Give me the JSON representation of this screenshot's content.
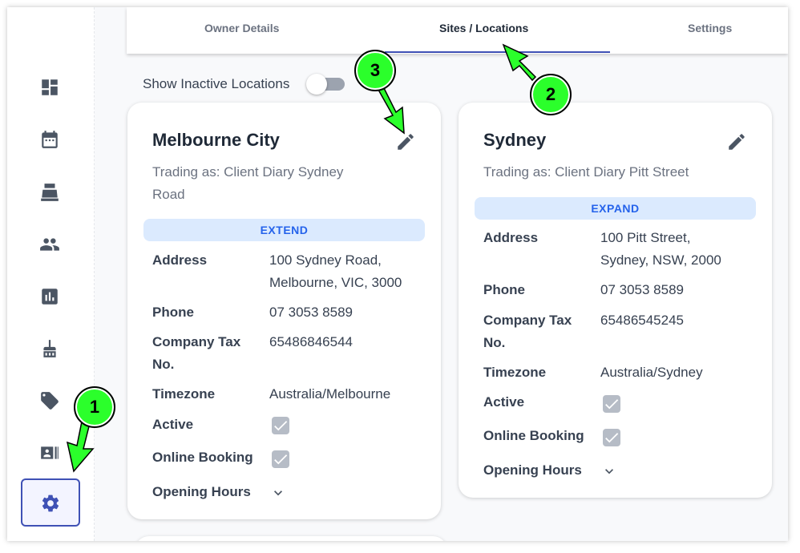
{
  "tabs": [
    {
      "label": "Owner Details"
    },
    {
      "label": "Sites / Locations"
    },
    {
      "label": "Settings"
    }
  ],
  "toggle": {
    "label": "Show Inactive Locations",
    "on": false
  },
  "locations": [
    {
      "name": "Melbourne City",
      "trading_line1": "Trading as: Client Diary Sydney",
      "trading_line2": "Road",
      "badge": "EXTEND",
      "address_label": "Address",
      "address_line1": "100 Sydney Road,",
      "address_line2": "Melbourne, VIC, 3000",
      "phone_label": "Phone",
      "phone": "07 3053 8589",
      "tax_label_line1": "Company Tax",
      "tax_label_line2": "No.",
      "tax": "65486846544",
      "timezone_label": "Timezone",
      "timezone": "Australia/Melbourne",
      "active_label": "Active",
      "online_booking_label": "Online Booking",
      "opening_hours_label": "Opening Hours"
    },
    {
      "name": "Sydney",
      "trading_line1": "Trading as: Client Diary Pitt Street",
      "badge": "EXPAND",
      "address_label": "Address",
      "address_line1": "100 Pitt Street,",
      "address_line2": "Sydney, NSW, 2000",
      "phone_label": "Phone",
      "phone": "07 3053 8589",
      "tax_label_line1": "Company Tax",
      "tax_label_line2": "No.",
      "tax": "65486545245",
      "timezone_label": "Timezone",
      "timezone": "Australia/Sydney",
      "active_label": "Active",
      "online_booking_label": "Online Booking",
      "opening_hours_label": "Opening Hours"
    }
  ],
  "sidebar": {
    "items": [
      {
        "icon": "dashboard-icon"
      },
      {
        "icon": "calendar-icon"
      },
      {
        "icon": "cash-register-icon"
      },
      {
        "icon": "people-icon"
      },
      {
        "icon": "reports-icon"
      },
      {
        "icon": "cleaning-icon"
      },
      {
        "icon": "tag-icon"
      },
      {
        "icon": "contact-card-icon"
      },
      {
        "icon": "settings-icon",
        "active": true
      }
    ]
  },
  "callouts": [
    "1",
    "2",
    "3"
  ],
  "colors": {
    "accent": "#3f51b5",
    "badge_bg": "#dbeafe",
    "badge_text": "#2563eb",
    "callout": "#2bff2b"
  }
}
